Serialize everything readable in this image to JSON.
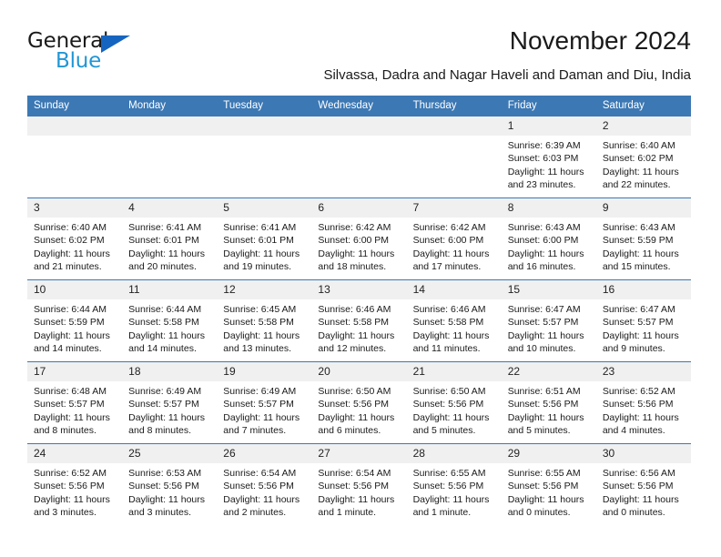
{
  "logo": {
    "word_top": "General",
    "word_bottom": "Blue",
    "triangle_color": "#1565c0",
    "blue_text_color": "#2196d4"
  },
  "header": {
    "title": "November 2024",
    "subtitle": "Silvassa, Dadra and Nagar Haveli and Daman and Diu, India"
  },
  "calendar": {
    "header_bg": "#3c78b4",
    "daynum_bg": "#f0f0f0",
    "weekdays": [
      "Sunday",
      "Monday",
      "Tuesday",
      "Wednesday",
      "Thursday",
      "Friday",
      "Saturday"
    ],
    "weeks": [
      [
        {
          "day": "",
          "sunrise": "",
          "sunset": "",
          "daylight1": "",
          "daylight2": ""
        },
        {
          "day": "",
          "sunrise": "",
          "sunset": "",
          "daylight1": "",
          "daylight2": ""
        },
        {
          "day": "",
          "sunrise": "",
          "sunset": "",
          "daylight1": "",
          "daylight2": ""
        },
        {
          "day": "",
          "sunrise": "",
          "sunset": "",
          "daylight1": "",
          "daylight2": ""
        },
        {
          "day": "",
          "sunrise": "",
          "sunset": "",
          "daylight1": "",
          "daylight2": ""
        },
        {
          "day": "1",
          "sunrise": "Sunrise: 6:39 AM",
          "sunset": "Sunset: 6:03 PM",
          "daylight1": "Daylight: 11 hours",
          "daylight2": "and 23 minutes."
        },
        {
          "day": "2",
          "sunrise": "Sunrise: 6:40 AM",
          "sunset": "Sunset: 6:02 PM",
          "daylight1": "Daylight: 11 hours",
          "daylight2": "and 22 minutes."
        }
      ],
      [
        {
          "day": "3",
          "sunrise": "Sunrise: 6:40 AM",
          "sunset": "Sunset: 6:02 PM",
          "daylight1": "Daylight: 11 hours",
          "daylight2": "and 21 minutes."
        },
        {
          "day": "4",
          "sunrise": "Sunrise: 6:41 AM",
          "sunset": "Sunset: 6:01 PM",
          "daylight1": "Daylight: 11 hours",
          "daylight2": "and 20 minutes."
        },
        {
          "day": "5",
          "sunrise": "Sunrise: 6:41 AM",
          "sunset": "Sunset: 6:01 PM",
          "daylight1": "Daylight: 11 hours",
          "daylight2": "and 19 minutes."
        },
        {
          "day": "6",
          "sunrise": "Sunrise: 6:42 AM",
          "sunset": "Sunset: 6:00 PM",
          "daylight1": "Daylight: 11 hours",
          "daylight2": "and 18 minutes."
        },
        {
          "day": "7",
          "sunrise": "Sunrise: 6:42 AM",
          "sunset": "Sunset: 6:00 PM",
          "daylight1": "Daylight: 11 hours",
          "daylight2": "and 17 minutes."
        },
        {
          "day": "8",
          "sunrise": "Sunrise: 6:43 AM",
          "sunset": "Sunset: 6:00 PM",
          "daylight1": "Daylight: 11 hours",
          "daylight2": "and 16 minutes."
        },
        {
          "day": "9",
          "sunrise": "Sunrise: 6:43 AM",
          "sunset": "Sunset: 5:59 PM",
          "daylight1": "Daylight: 11 hours",
          "daylight2": "and 15 minutes."
        }
      ],
      [
        {
          "day": "10",
          "sunrise": "Sunrise: 6:44 AM",
          "sunset": "Sunset: 5:59 PM",
          "daylight1": "Daylight: 11 hours",
          "daylight2": "and 14 minutes."
        },
        {
          "day": "11",
          "sunrise": "Sunrise: 6:44 AM",
          "sunset": "Sunset: 5:58 PM",
          "daylight1": "Daylight: 11 hours",
          "daylight2": "and 14 minutes."
        },
        {
          "day": "12",
          "sunrise": "Sunrise: 6:45 AM",
          "sunset": "Sunset: 5:58 PM",
          "daylight1": "Daylight: 11 hours",
          "daylight2": "and 13 minutes."
        },
        {
          "day": "13",
          "sunrise": "Sunrise: 6:46 AM",
          "sunset": "Sunset: 5:58 PM",
          "daylight1": "Daylight: 11 hours",
          "daylight2": "and 12 minutes."
        },
        {
          "day": "14",
          "sunrise": "Sunrise: 6:46 AM",
          "sunset": "Sunset: 5:58 PM",
          "daylight1": "Daylight: 11 hours",
          "daylight2": "and 11 minutes."
        },
        {
          "day": "15",
          "sunrise": "Sunrise: 6:47 AM",
          "sunset": "Sunset: 5:57 PM",
          "daylight1": "Daylight: 11 hours",
          "daylight2": "and 10 minutes."
        },
        {
          "day": "16",
          "sunrise": "Sunrise: 6:47 AM",
          "sunset": "Sunset: 5:57 PM",
          "daylight1": "Daylight: 11 hours",
          "daylight2": "and 9 minutes."
        }
      ],
      [
        {
          "day": "17",
          "sunrise": "Sunrise: 6:48 AM",
          "sunset": "Sunset: 5:57 PM",
          "daylight1": "Daylight: 11 hours",
          "daylight2": "and 8 minutes."
        },
        {
          "day": "18",
          "sunrise": "Sunrise: 6:49 AM",
          "sunset": "Sunset: 5:57 PM",
          "daylight1": "Daylight: 11 hours",
          "daylight2": "and 8 minutes."
        },
        {
          "day": "19",
          "sunrise": "Sunrise: 6:49 AM",
          "sunset": "Sunset: 5:57 PM",
          "daylight1": "Daylight: 11 hours",
          "daylight2": "and 7 minutes."
        },
        {
          "day": "20",
          "sunrise": "Sunrise: 6:50 AM",
          "sunset": "Sunset: 5:56 PM",
          "daylight1": "Daylight: 11 hours",
          "daylight2": "and 6 minutes."
        },
        {
          "day": "21",
          "sunrise": "Sunrise: 6:50 AM",
          "sunset": "Sunset: 5:56 PM",
          "daylight1": "Daylight: 11 hours",
          "daylight2": "and 5 minutes."
        },
        {
          "day": "22",
          "sunrise": "Sunrise: 6:51 AM",
          "sunset": "Sunset: 5:56 PM",
          "daylight1": "Daylight: 11 hours",
          "daylight2": "and 5 minutes."
        },
        {
          "day": "23",
          "sunrise": "Sunrise: 6:52 AM",
          "sunset": "Sunset: 5:56 PM",
          "daylight1": "Daylight: 11 hours",
          "daylight2": "and 4 minutes."
        }
      ],
      [
        {
          "day": "24",
          "sunrise": "Sunrise: 6:52 AM",
          "sunset": "Sunset: 5:56 PM",
          "daylight1": "Daylight: 11 hours",
          "daylight2": "and 3 minutes."
        },
        {
          "day": "25",
          "sunrise": "Sunrise: 6:53 AM",
          "sunset": "Sunset: 5:56 PM",
          "daylight1": "Daylight: 11 hours",
          "daylight2": "and 3 minutes."
        },
        {
          "day": "26",
          "sunrise": "Sunrise: 6:54 AM",
          "sunset": "Sunset: 5:56 PM",
          "daylight1": "Daylight: 11 hours",
          "daylight2": "and 2 minutes."
        },
        {
          "day": "27",
          "sunrise": "Sunrise: 6:54 AM",
          "sunset": "Sunset: 5:56 PM",
          "daylight1": "Daylight: 11 hours",
          "daylight2": "and 1 minute."
        },
        {
          "day": "28",
          "sunrise": "Sunrise: 6:55 AM",
          "sunset": "Sunset: 5:56 PM",
          "daylight1": "Daylight: 11 hours",
          "daylight2": "and 1 minute."
        },
        {
          "day": "29",
          "sunrise": "Sunrise: 6:55 AM",
          "sunset": "Sunset: 5:56 PM",
          "daylight1": "Daylight: 11 hours",
          "daylight2": "and 0 minutes."
        },
        {
          "day": "30",
          "sunrise": "Sunrise: 6:56 AM",
          "sunset": "Sunset: 5:56 PM",
          "daylight1": "Daylight: 11 hours",
          "daylight2": "and 0 minutes."
        }
      ]
    ]
  }
}
